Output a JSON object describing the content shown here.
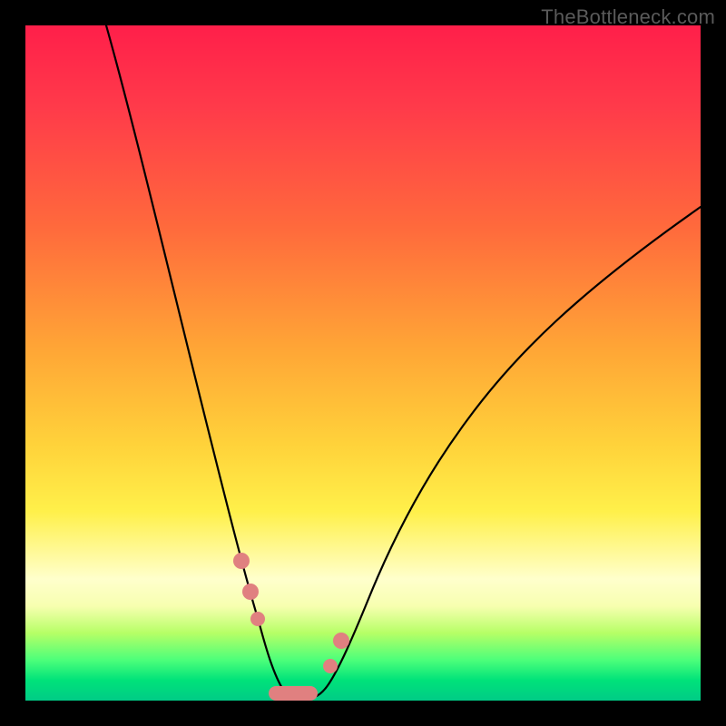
{
  "watermark": "TheBottleneck.com",
  "colors": {
    "frame": "#000000",
    "gradient_top": "#ff1f4a",
    "gradient_mid": "#ffd23a",
    "gradient_bottom": "#00cc86",
    "curve": "#000000",
    "marker": "#e08080"
  },
  "chart_data": {
    "type": "line",
    "title": "",
    "xlabel": "",
    "ylabel": "",
    "xlim": [
      0,
      100
    ],
    "ylim": [
      0,
      100
    ],
    "x": [
      12,
      14,
      16,
      18,
      20,
      22,
      24,
      26,
      28,
      30,
      31,
      32,
      33,
      34,
      35,
      36,
      37,
      38,
      39,
      40,
      42,
      44,
      46,
      48,
      50,
      54,
      58,
      62,
      66,
      70,
      76,
      82,
      88,
      94,
      100
    ],
    "y": [
      100,
      92,
      84,
      76,
      68,
      60,
      53,
      46,
      39,
      32,
      28,
      24,
      20,
      15,
      10,
      6,
      3,
      1,
      0,
      0,
      1,
      4,
      8,
      13,
      18,
      26,
      33,
      39,
      45,
      50,
      56,
      62,
      66,
      70,
      73
    ],
    "minimum_x": 38,
    "markers": [
      {
        "x": 31,
        "y": 24,
        "shape": "dot"
      },
      {
        "x": 32,
        "y": 18,
        "shape": "dot"
      },
      {
        "x": 33,
        "y": 12,
        "shape": "dot"
      },
      {
        "x": 36.5,
        "y": 1.5,
        "shape": "pill"
      },
      {
        "x": 42,
        "y": 7,
        "shape": "dot"
      },
      {
        "x": 44,
        "y": 14,
        "shape": "dot"
      }
    ]
  }
}
